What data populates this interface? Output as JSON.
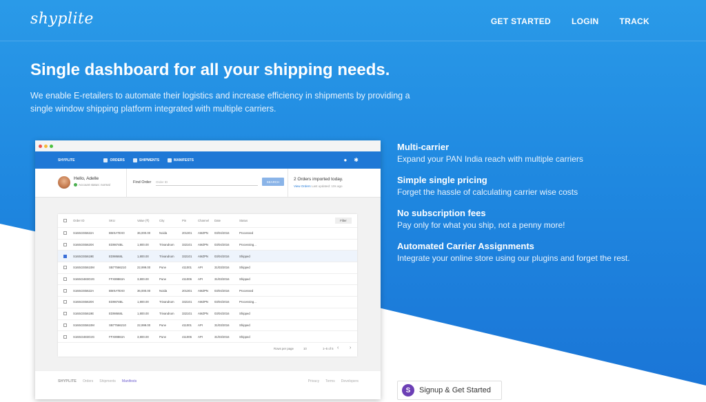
{
  "brand": {
    "logo_text": "shyplite"
  },
  "nav": {
    "items": [
      "GET STARTED",
      "LOGIN",
      "TRACK"
    ]
  },
  "hero": {
    "title": "Single dashboard for all your shipping needs.",
    "description": "We enable E-retailers to automate their logistics and increase efficiency in shipments by providing a single window shipping platform integrated with multiple carriers."
  },
  "mock": {
    "app_brand": "SHYPLITE",
    "tabs": [
      "ORDERS",
      "SHIPMENTS",
      "MANIFESTS"
    ],
    "greeting": "Hello, Adelle",
    "account_status": "Account status: normal",
    "find_label": "Find Order",
    "order_placeholder": "Order ID",
    "search_label": "SEARCH",
    "imported": "2 Orders imported today.",
    "view_orders": "View Orders",
    "last_updated": "Last updated: 10s ago",
    "filter_label": "Filter",
    "columns": [
      "Order ID",
      "SKU",
      "Value (₹)",
      "City",
      "Pin",
      "Channel",
      "Date",
      "Status"
    ],
    "rows": [
      [
        "S16043S5622A",
        "BMXATEX0",
        "36,000.00",
        "Noida",
        "201301",
        "AMZPN",
        "03/04/2016",
        "Processed"
      ],
      [
        "S16043S5620X",
        "ED9874BL",
        "1,800.00",
        "Trivandrum",
        "332101",
        "AMZPN",
        "03/04/2016",
        "Processing..."
      ],
      [
        "S16043S5619E",
        "ED98668L",
        "1,800.00",
        "Trivandrum",
        "332101",
        "AMZPN",
        "03/04/2016",
        "Shipped"
      ],
      [
        "S16043S5610M",
        "SB77566210",
        "22,999.00",
        "Pune",
        "411001",
        "API",
        "31/03/2016",
        "Shipped"
      ],
      [
        "S16043483O2G",
        "FFX89863A",
        "3,800.00",
        "Pune",
        "411006",
        "API",
        "31/03/2016",
        "Shipped"
      ],
      [
        "S16043S5622A",
        "BMXATEX0",
        "36,000.00",
        "Noida",
        "201301",
        "AMZPN",
        "03/04/2016",
        "Processed"
      ],
      [
        "S16043S5620X",
        "ED9874BL",
        "1,800.00",
        "Trivandrum",
        "332101",
        "AMZPN",
        "03/04/2016",
        "Processing..."
      ],
      [
        "S16043S5619E",
        "ED98668L",
        "1,800.00",
        "Trivandrum",
        "332101",
        "AMZPN",
        "03/04/2016",
        "Shipped"
      ],
      [
        "S16043S5610M",
        "SB77566210",
        "22,999.00",
        "Pune",
        "411001",
        "API",
        "31/03/2016",
        "Shipped"
      ],
      [
        "S16043483O2G",
        "FFX89863A",
        "3,800.00",
        "Pune",
        "411006",
        "API",
        "31/03/2016",
        "Shipped"
      ]
    ],
    "selected_row": 2,
    "pager": {
      "rows_per_page_label": "Rows per page",
      "rows_per_page": "10",
      "range": "1–5 of 5"
    },
    "footer_brand": "SHYPLITE",
    "footer_links": [
      "Orders",
      "Shipments",
      "Manifests"
    ],
    "footer_active": "Manifests",
    "footer_right": [
      "Privacy",
      "Terms",
      "Developers"
    ]
  },
  "features": [
    {
      "title": "Multi-carrier",
      "text": "Expand your PAN India reach with multiple carriers"
    },
    {
      "title": "Simple single pricing",
      "text": "Forget the hassle of calculating carrier wise costs"
    },
    {
      "title": "No subscription fees",
      "text": "Pay only for what you ship, not a penny more!"
    },
    {
      "title": "Automated Carrier Assignments",
      "text": "Integrate your online store using our plugins and forget the rest."
    }
  ],
  "signup": {
    "icon_letter": "S",
    "label": "Signup & Get Started"
  },
  "colors": {
    "primary": "#2196f3",
    "app_bar": "#1f78d6",
    "signup_icon": "#6c3fb5"
  }
}
